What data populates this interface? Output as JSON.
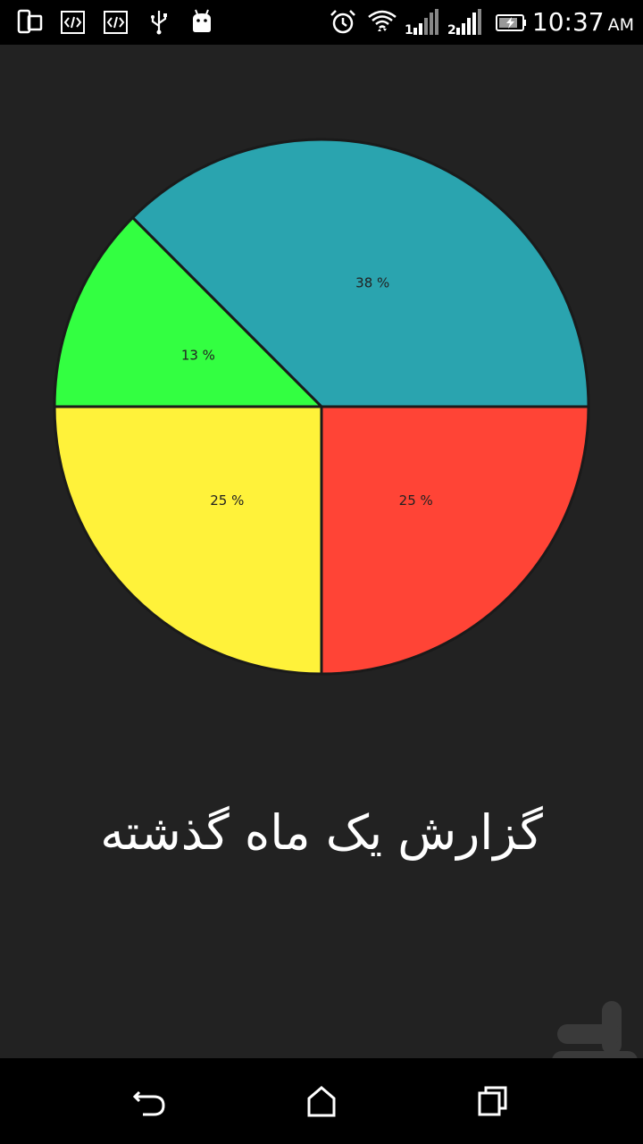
{
  "status_bar": {
    "time": "10:37",
    "ampm": "AM",
    "left_icons": [
      "phone-dual-icon",
      "code-icon",
      "code-icon",
      "usb-icon",
      "android-icon"
    ],
    "right_icons": [
      "alarm-icon",
      "wifi-icon",
      "signal-sim1-icon",
      "signal-sim2-icon",
      "battery-charging-icon"
    ],
    "sim1_label": "1",
    "sim2_label": "2"
  },
  "chart_data": {
    "type": "pie",
    "title": "",
    "slices": [
      {
        "label": "38 %",
        "value": 37.5,
        "color": "#2AA4AF"
      },
      {
        "label": "13 %",
        "value": 12.5,
        "color": "#33FF41"
      },
      {
        "label": "25 %",
        "value": 25,
        "color": "#FFF23A"
      },
      {
        "label": "25 %",
        "value": 25,
        "color": "#FF4436"
      }
    ],
    "start_angle_deg": 0,
    "border_color": "#1a1a1a"
  },
  "report": {
    "title": "گزارش یک ماه گذشته"
  },
  "nav_bar": {
    "icons": [
      "back-icon",
      "home-icon",
      "recents-icon"
    ]
  },
  "colors": {
    "background": "#222222",
    "bars": "#000000"
  }
}
